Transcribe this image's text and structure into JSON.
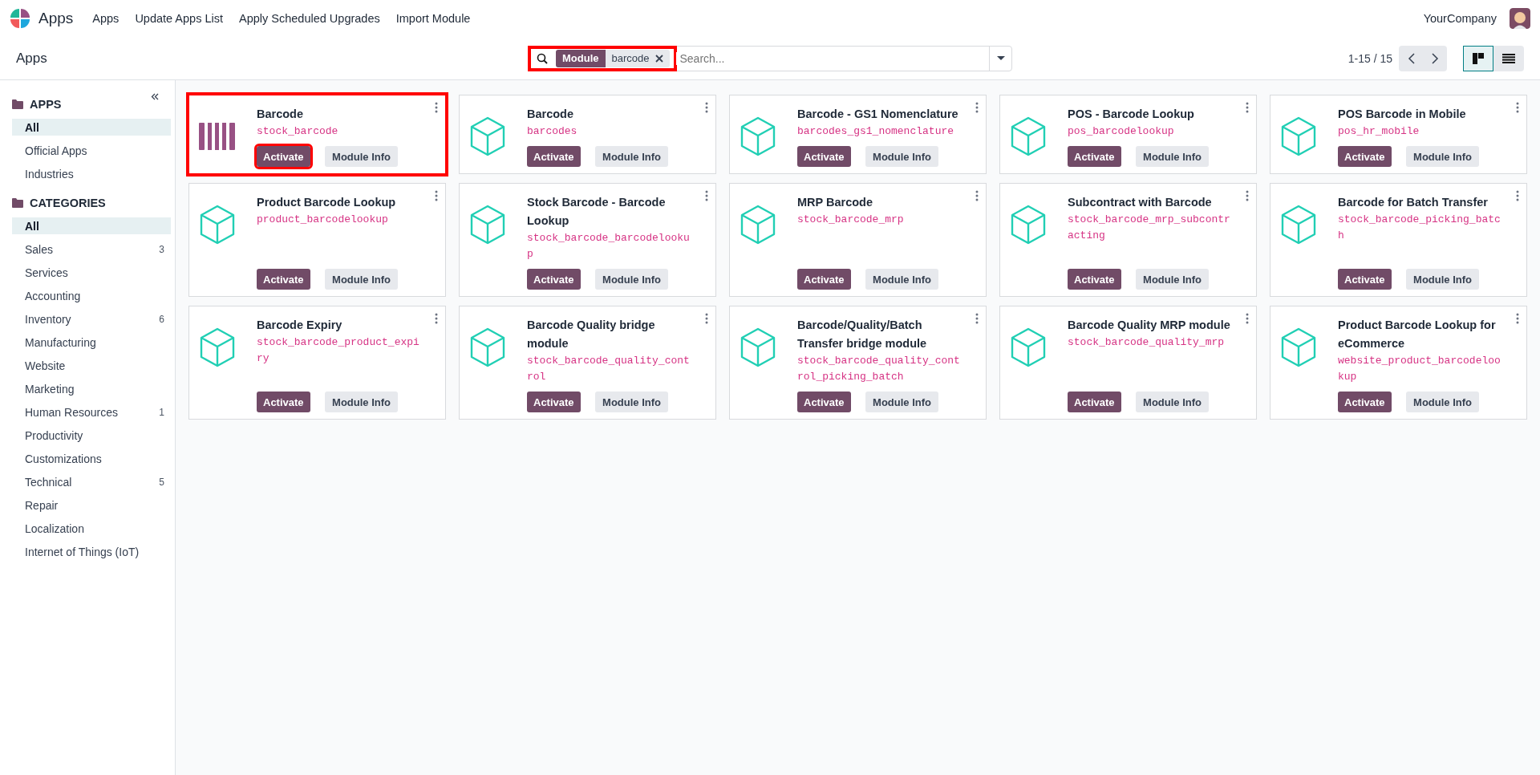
{
  "navbar": {
    "brand": "Apps",
    "menu": [
      "Apps",
      "Update Apps List",
      "Apply Scheduled Upgrades",
      "Import Module"
    ],
    "company": "YourCompany"
  },
  "control_panel": {
    "breadcrumb": "Apps",
    "search": {
      "highlighted": true,
      "facets": [
        {
          "label": "Module",
          "value": "barcode"
        }
      ],
      "placeholder": "Search..."
    },
    "pager": "1-15 / 15",
    "views": [
      {
        "kind": "kanban",
        "selected": true
      },
      {
        "kind": "list",
        "selected": false
      }
    ]
  },
  "sidebar": {
    "sections": [
      {
        "title": "APPS",
        "items": [
          {
            "label": "All",
            "selected": true
          },
          {
            "label": "Official Apps",
            "selected": false
          },
          {
            "label": "Industries",
            "selected": false
          }
        ]
      },
      {
        "title": "CATEGORIES",
        "items": [
          {
            "label": "All",
            "selected": true
          },
          {
            "label": "Sales",
            "count": "3",
            "selected": false
          },
          {
            "label": "Services",
            "selected": false
          },
          {
            "label": "Accounting",
            "selected": false
          },
          {
            "label": "Inventory",
            "count": "6",
            "selected": false
          },
          {
            "label": "Manufacturing",
            "selected": false
          },
          {
            "label": "Website",
            "selected": false
          },
          {
            "label": "Marketing",
            "selected": false
          },
          {
            "label": "Human Resources",
            "count": "1",
            "selected": false
          },
          {
            "label": "Productivity",
            "selected": false
          },
          {
            "label": "Customizations",
            "selected": false
          },
          {
            "label": "Technical",
            "count": "5",
            "selected": false
          },
          {
            "label": "Repair",
            "selected": false
          },
          {
            "label": "Localization",
            "selected": false
          },
          {
            "label": "Internet of Things (IoT)",
            "selected": false
          }
        ]
      }
    ]
  },
  "cards": [
    {
      "title": "Barcode",
      "technical_name": "stock_barcode",
      "kind": "barcode",
      "highlighted": true,
      "activate": "Activate",
      "info": "Module Info"
    },
    {
      "title": "Barcode",
      "technical_name": "barcodes",
      "kind": "cube",
      "highlighted": false,
      "activate": "Activate",
      "info": "Module Info"
    },
    {
      "title": "Barcode - GS1 Nomenclature",
      "technical_name": "barcodes_gs1_nomenclature",
      "kind": "cube",
      "highlighted": false,
      "activate": "Activate",
      "info": "Module Info"
    },
    {
      "title": "POS - Barcode Lookup",
      "technical_name": "pos_barcodelookup",
      "kind": "cube",
      "highlighted": false,
      "activate": "Activate",
      "info": "Module Info"
    },
    {
      "title": "POS Barcode in Mobile",
      "technical_name": "pos_hr_mobile",
      "kind": "cube",
      "highlighted": false,
      "activate": "Activate",
      "info": "Module Info"
    },
    {
      "title": "Product Barcode Lookup",
      "technical_name": "product_barcodelookup",
      "kind": "cube",
      "highlighted": false,
      "activate": "Activate",
      "info": "Module Info"
    },
    {
      "title": "Stock Barcode - Barcode Lookup",
      "technical_name": "stock_barcode_barcodelookup",
      "kind": "cube",
      "highlighted": false,
      "activate": "Activate",
      "info": "Module Info"
    },
    {
      "title": "MRP Barcode",
      "technical_name": "stock_barcode_mrp",
      "kind": "cube",
      "highlighted": false,
      "activate": "Activate",
      "info": "Module Info"
    },
    {
      "title": "Subcontract with Barcode",
      "technical_name": "stock_barcode_mrp_subcontracting",
      "kind": "cube",
      "highlighted": false,
      "activate": "Activate",
      "info": "Module Info"
    },
    {
      "title": "Barcode for Batch Transfer",
      "technical_name": "stock_barcode_picking_batch",
      "kind": "cube",
      "highlighted": false,
      "activate": "Activate",
      "info": "Module Info"
    },
    {
      "title": "Barcode Expiry",
      "technical_name": "stock_barcode_product_expiry",
      "kind": "cube",
      "highlighted": false,
      "activate": "Activate",
      "info": "Module Info"
    },
    {
      "title": "Barcode Quality bridge module",
      "technical_name": "stock_barcode_quality_control",
      "kind": "cube",
      "highlighted": false,
      "activate": "Activate",
      "info": "Module Info"
    },
    {
      "title": "Barcode/Quality/Batch Transfer bridge module",
      "technical_name": "stock_barcode_quality_control_picking_batch",
      "kind": "cube",
      "highlighted": false,
      "activate": "Activate",
      "info": "Module Info"
    },
    {
      "title": "Barcode Quality MRP module",
      "technical_name": "stock_barcode_quality_mrp",
      "kind": "cube",
      "highlighted": false,
      "activate": "Activate",
      "info": "Module Info"
    },
    {
      "title": "Product Barcode Lookup for eCommerce",
      "technical_name": "website_product_barcodelookup",
      "kind": "cube",
      "highlighted": false,
      "activate": "Activate",
      "info": "Module Info"
    }
  ]
}
